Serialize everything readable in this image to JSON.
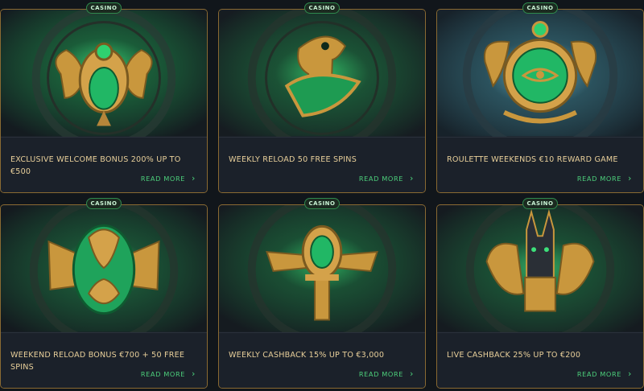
{
  "colors": {
    "background": "#11161b",
    "card_border": "#8a6a32",
    "title_text": "#e8cf9a",
    "link_green": "#4ccf7b",
    "badge_green": "#2f8a4d",
    "gold": "#c9973d",
    "emerald": "#21b765"
  },
  "promotions": [
    {
      "badge": "CASINO",
      "title": "EXCLUSIVE WELCOME BONUS 200% UP TO €500",
      "read_more": "READ MORE",
      "icon": "scarab-icon"
    },
    {
      "badge": "CASINO",
      "title": "WEEKLY RELOAD 50 FREE SPINS",
      "read_more": "READ MORE",
      "icon": "horus-falcon-icon"
    },
    {
      "badge": "CASINO",
      "title": "ROULETTE WEEKENDS €10 REWARD GAME",
      "read_more": "READ MORE",
      "icon": "eye-of-horus-amulet-icon"
    },
    {
      "badge": "CASINO",
      "title": "WEEKEND RELOAD BONUS €700 + 50 FREE SPINS",
      "read_more": "READ MORE",
      "icon": "serpent-amulet-icon"
    },
    {
      "badge": "CASINO",
      "title": "WEEKLY CASHBACK 15% UP TO €3,000",
      "read_more": "READ MORE",
      "icon": "ankh-wings-icon"
    },
    {
      "badge": "CASINO",
      "title": "LIVE CASHBACK 25% UP TO €200",
      "read_more": "READ MORE",
      "icon": "anubis-icon"
    }
  ]
}
